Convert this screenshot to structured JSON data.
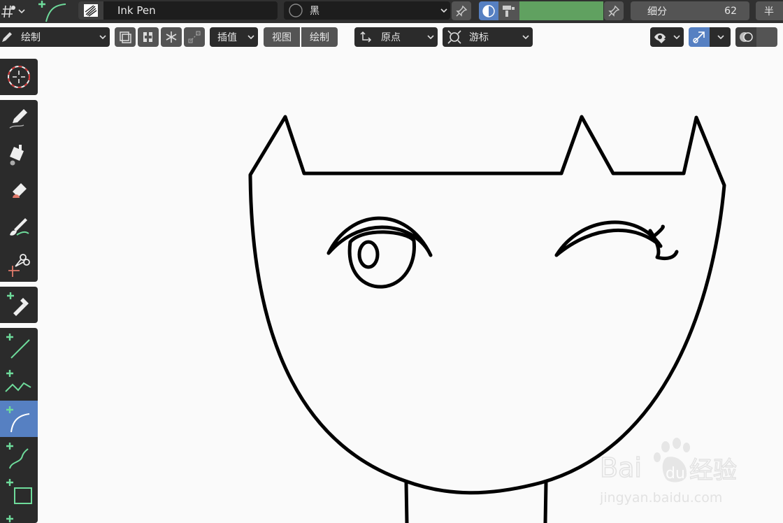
{
  "header": {
    "brush_name": "Ink Pen",
    "material_name": "黑",
    "subdivision_label": "细分",
    "subdivision_value": "62",
    "cut_label": "半",
    "color_strength_fill": "#60a160"
  },
  "toolbar": {
    "mode_label": "绘制",
    "interpolate_label": "插值",
    "view_label": "视图",
    "draw_label": "绘制",
    "origin_label": "原点",
    "cursor_label": "游标"
  },
  "tools": [
    "cursor-tool",
    "draw-tool",
    "fill-tool",
    "erase-tool",
    "tint-tool",
    "cutter-tool",
    "eyedropper-tool",
    "line-tool",
    "polyline-tool",
    "arc-tool",
    "curve-tool",
    "box-tool",
    "circle-tool"
  ],
  "active_tool": "arc-tool",
  "colors": {
    "panel": "#303030",
    "field": "#1d1d1d",
    "button": "#545454",
    "accent": "#5680c2",
    "green": "#6edb9b",
    "canvas": "#fafafa",
    "stroke": "#000000"
  },
  "watermark": {
    "brand_left": "Bai",
    "brand_right": "经验",
    "url": "jingyan.baidu.com"
  }
}
